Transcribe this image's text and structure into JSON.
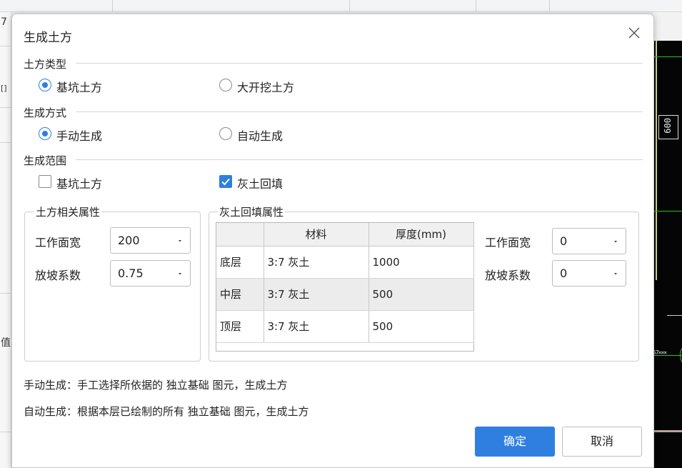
{
  "background": {
    "left_texts": [
      "7",
      "[]",
      "值"
    ],
    "canvas_dimension": "600",
    "canvas_label": "57×××"
  },
  "dialog": {
    "title": "生成土方",
    "close_icon": "close-icon",
    "earthwork_type": {
      "label": "土方类型",
      "options": [
        {
          "label": "基坑土方",
          "checked": true
        },
        {
          "label": "大开挖土方",
          "checked": false
        }
      ]
    },
    "generate_mode": {
      "label": "生成方式",
      "options": [
        {
          "label": "手动生成",
          "checked": true
        },
        {
          "label": "自动生成",
          "checked": false
        }
      ]
    },
    "generate_scope": {
      "label": "生成范围",
      "options": [
        {
          "label": "基坑土方",
          "checked": false
        },
        {
          "label": "灰土回填",
          "checked": true
        }
      ]
    },
    "earthwork_props": {
      "title": "土方相关属性",
      "work_width_label": "工作面宽",
      "work_width_value": "200",
      "slope_label": "放坡系数",
      "slope_value": "0.75"
    },
    "backfill_props": {
      "title": "灰土回填属性",
      "table": {
        "headers": [
          "",
          "材料",
          "厚度(mm)"
        ],
        "rows": [
          [
            "底层",
            "3:7 灰土",
            "1000"
          ],
          [
            "中层",
            "3:7 灰土",
            "500"
          ],
          [
            "顶层",
            "3:7 灰土",
            "500"
          ]
        ]
      },
      "work_width_label": "工作面宽",
      "work_width_value": "0",
      "slope_label": "放坡系数",
      "slope_value": "0"
    },
    "desc_manual": "手动生成：手工选择所依据的 独立基础 图元，生成土方",
    "desc_auto": "自动生成：根据本层已绘制的所有 独立基础 图元，生成土方",
    "ok_label": "确定",
    "cancel_label": "取消"
  },
  "colors": {
    "accent": "#2f7fe0",
    "canvas_bg": "#050505"
  }
}
